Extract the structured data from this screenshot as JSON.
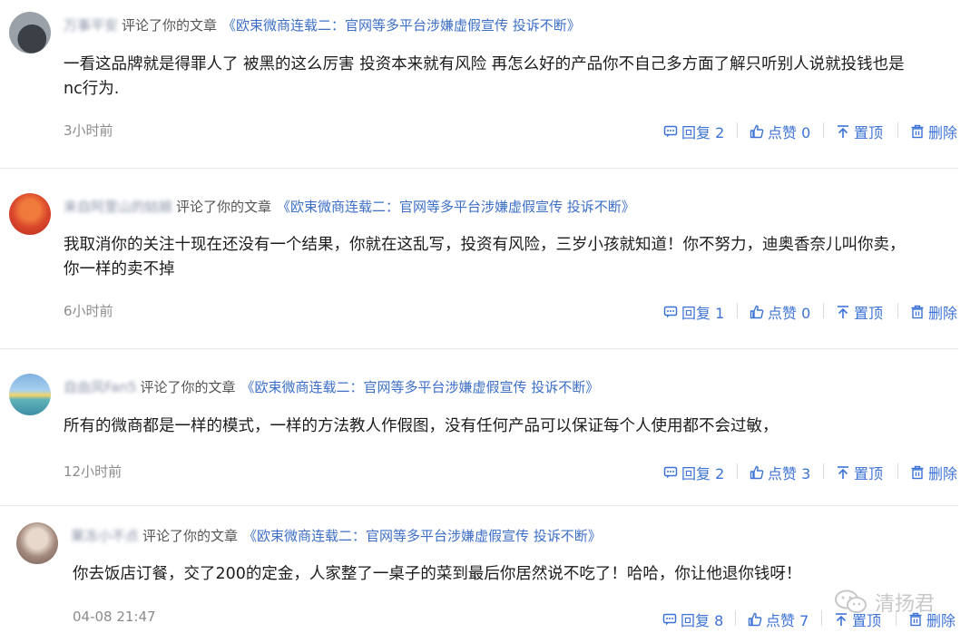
{
  "comments": [
    {
      "username": "万事平安",
      "verb": "评论了你的文章",
      "article": "《欧束微商连载二：官网等多平台涉嫌虚假宣传 投诉不断》",
      "text_lines": [
        "一看这品牌就是得罪人了 被黑的这么厉害 投资本来就有风险 再怎么好的产品你不自己多方面了解只听别人说就投钱也是",
        "nc行为."
      ],
      "time": "3小时前",
      "reply": "回复 2",
      "like": "点赞 0",
      "pin": "置顶",
      "delete": "删除"
    },
    {
      "username": "来自阿里山的姑娘",
      "verb": "评论了你的文章",
      "article": "《欧束微商连载二：官网等多平台涉嫌虚假宣传 投诉不断》",
      "text_lines": [
        "我取消你的关注十现在还没有一个结果，你就在这乱写，投资有风险，三岁小孩就知道！你不努力，迪奥香奈儿叫你卖，",
        "你一样的卖不掉"
      ],
      "time": "6小时前",
      "reply": "回复 1",
      "like": "点赞 0",
      "pin": "置顶",
      "delete": "删除"
    },
    {
      "username": "自由风Fan5",
      "verb": "评论了你的文章",
      "article": "《欧束微商连载二：官网等多平台涉嫌虚假宣传 投诉不断》",
      "text_lines": [
        "所有的微商都是一样的模式，一样的方法教人作假图，没有任何产品可以保证每个人使用都不会过敏，"
      ],
      "time": "12小时前",
      "reply": "回复 2",
      "like": "点赞 3",
      "pin": "置顶",
      "delete": "删除"
    },
    {
      "username": "果冻小不点",
      "verb": "评论了你的文章",
      "article": "《欧束微商连载二：官网等多平台涉嫌虚假宣传 投诉不断》",
      "text_lines": [
        "你去饭店订餐，交了200的定金，人家整了一桌子的菜到最后你居然说不吃了！哈哈，你让他退你钱呀！"
      ],
      "time": "04-08 21:47",
      "reply": "回复 8",
      "like": "点赞 7",
      "pin": "置顶",
      "delete": "删除"
    }
  ],
  "watermark": "清扬君",
  "colors": {
    "link": "#3d73d6",
    "article": "#3d6fc7",
    "muted": "#8c8c8c"
  }
}
